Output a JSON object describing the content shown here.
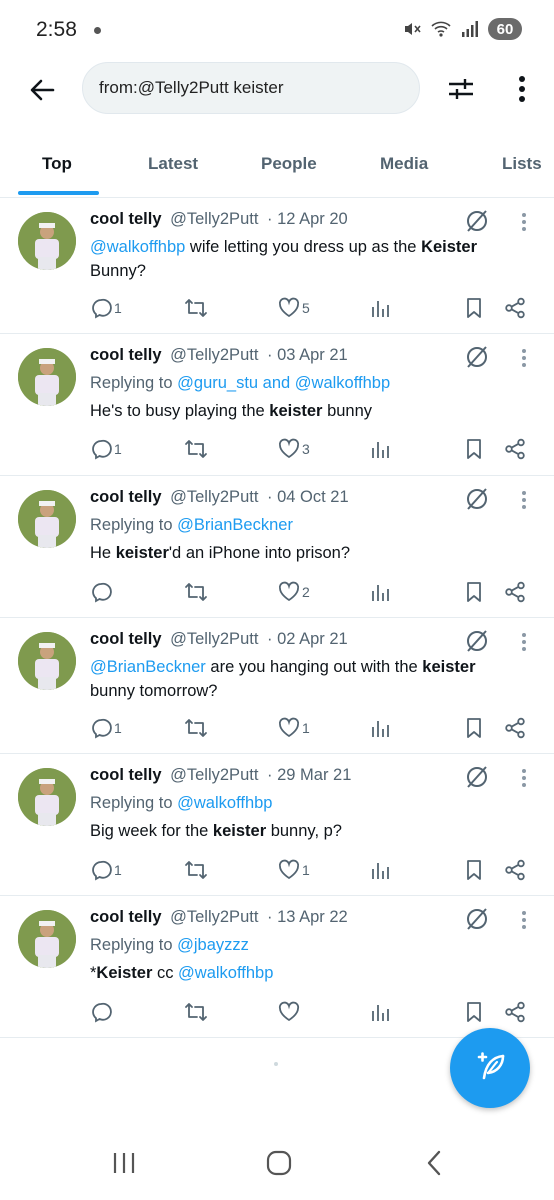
{
  "status": {
    "time": "2:58",
    "battery": "60"
  },
  "search": {
    "query": "from:@Telly2Putt keister"
  },
  "tabs": [
    {
      "label": "Top",
      "active": true
    },
    {
      "label": "Latest"
    },
    {
      "label": "People"
    },
    {
      "label": "Media"
    },
    {
      "label": "Lists"
    }
  ],
  "tweets": [
    {
      "name": "cool telly",
      "handle": "@Telly2Putt",
      "date": "· 12 Apr 20",
      "text": {
        "mention": "@walkoffhbp",
        "part1": " wife letting you dress up as the ",
        "keyword": "Keister",
        "line2": "Bunny?"
      },
      "replies": "1",
      "retweets": "",
      "likes": "5"
    },
    {
      "name": "cool telly",
      "handle": "@Telly2Putt",
      "date": "· 03 Apr 21",
      "reply_to": {
        "prefix": "Replying to ",
        "users": "@guru_stu and @walkoffhbp"
      },
      "text": {
        "part1": "He's to busy playing the ",
        "keyword": "keister",
        "part2": " bunny"
      },
      "replies": "1",
      "retweets": "",
      "likes": "3"
    },
    {
      "name": "cool telly",
      "handle": "@Telly2Putt",
      "date": "· 04 Oct 21",
      "reply_to": {
        "prefix": "Replying to ",
        "users": "@BrianBeckner"
      },
      "text": {
        "part1": "He ",
        "keyword": "keister",
        "part2": "'d an iPhone into prison?"
      },
      "replies": "",
      "retweets": "",
      "likes": "2"
    },
    {
      "name": "cool telly",
      "handle": "@Telly2Putt",
      "date": "· 02 Apr 21",
      "text": {
        "mention": "@BrianBeckner",
        "part1": " are you hanging out with the ",
        "keyword": "keister",
        "line2": "bunny tomorrow?"
      },
      "replies": "1",
      "retweets": "",
      "likes": "1"
    },
    {
      "name": "cool telly",
      "handle": "@Telly2Putt",
      "date": "· 29 Mar 21",
      "reply_to": {
        "prefix": "Replying to ",
        "users": "@walkoffhbp"
      },
      "text": {
        "part1": "Big week for the ",
        "keyword": "keister",
        "part2": " bunny, p?"
      },
      "replies": "1",
      "retweets": "",
      "likes": "1"
    },
    {
      "name": "cool telly",
      "handle": "@Telly2Putt",
      "date": "· 13 Apr 22",
      "reply_to": {
        "prefix": "Replying to ",
        "users": "@jbayzzz"
      },
      "text": {
        "part1": "*",
        "keyword": "Keister",
        "part2": " cc ",
        "mention": "@walkoffhbp"
      },
      "replies": "",
      "retweets": "",
      "likes": ""
    }
  ],
  "colors": {
    "accent": "#1d9bf0",
    "text": "#0f1419",
    "muted": "#536471"
  }
}
